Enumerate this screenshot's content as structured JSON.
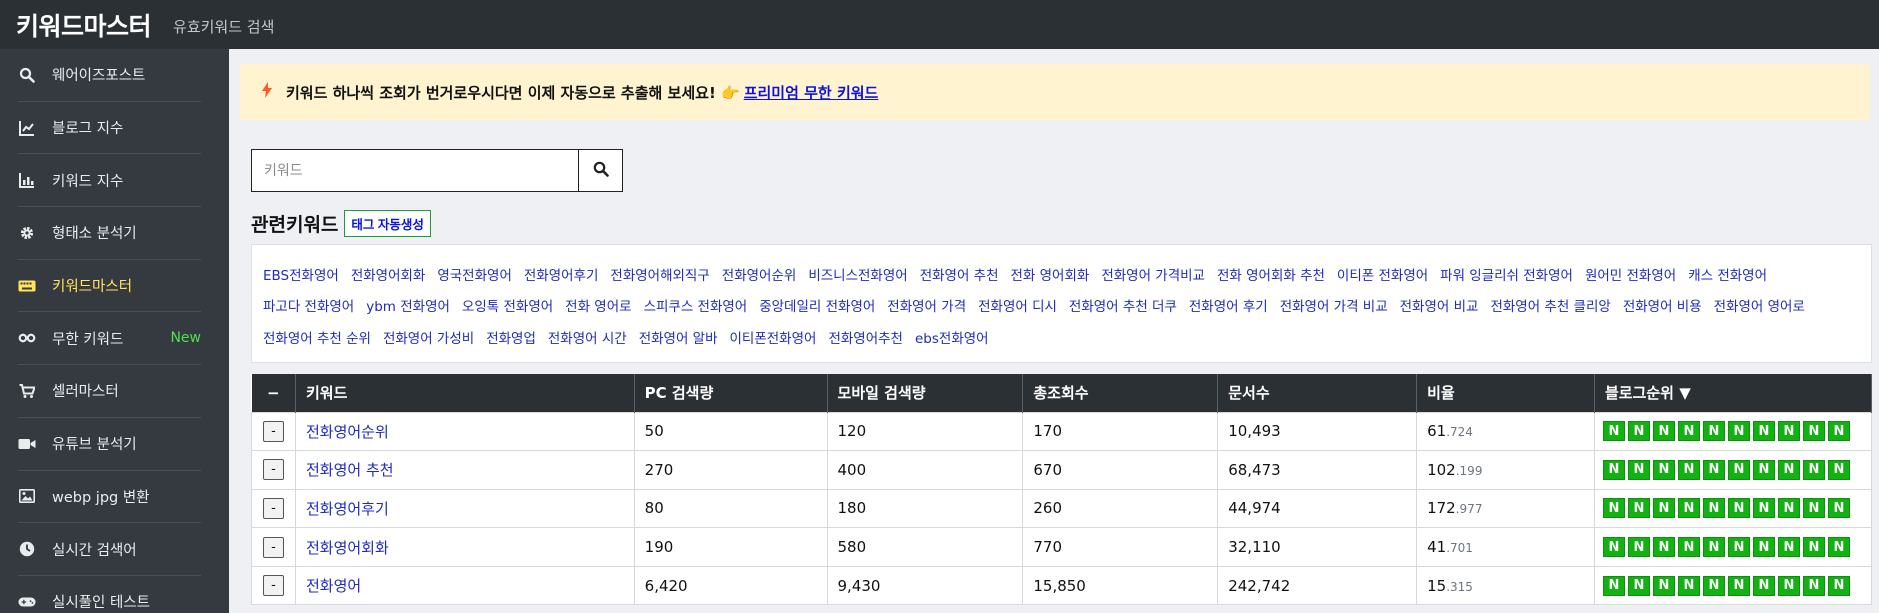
{
  "header": {
    "brand": "키워드마스터",
    "subtitle": "유효키워드 검색"
  },
  "colors": {
    "topbar": "#2b3035",
    "sidebar": "#343a40",
    "active": "#ffe45c",
    "new_badge": "#4ee24e",
    "naver_badge": "#12b212",
    "link": "#1f2bbd",
    "notice_bg": "#fff4cf"
  },
  "sidebar": {
    "items": [
      {
        "label": "웨어이즈포스트",
        "icon": "search-icon"
      },
      {
        "label": "블로그 지수",
        "icon": "line-chart-icon"
      },
      {
        "label": "키워드 지수",
        "icon": "bar-chart-icon"
      },
      {
        "label": "형태소 분석기",
        "icon": "gear-icon"
      },
      {
        "label": "키워드마스터",
        "icon": "keyboard-icon",
        "active": true
      },
      {
        "label": "무한 키워드",
        "icon": "infinity-icon",
        "badge": "New"
      },
      {
        "label": "셀러마스터",
        "icon": "cart-icon"
      },
      {
        "label": "유튜브 분석기",
        "icon": "video-camera-icon"
      },
      {
        "label": "webp jpg 변환",
        "icon": "image-icon"
      },
      {
        "label": "실시간 검색어",
        "icon": "clock-icon"
      },
      {
        "label": "실시풀인 테스트",
        "icon": "gamepad-icon"
      }
    ]
  },
  "notice": {
    "text": "키워드 하나씩 조회가 번거로우시다면 이제 자동으로 추출해 보세요! 👉",
    "link": "프리미엄 무한 키워드"
  },
  "search": {
    "placeholder": "키워드"
  },
  "related": {
    "title": "관련키워드",
    "tag_button": "태그 자동생성",
    "rows": [
      [
        "EBS전화영어",
        "전화영어회화",
        "영국전화영어",
        "전화영어후기",
        "전화영어해외직구",
        "전화영어순위",
        "비즈니스전화영어",
        "전화영어 추천",
        "전화 영어회화",
        "전화영어 가격비교",
        "전화 영어회화 추천",
        "이티폰 전화영어",
        "파워 잉글리쉬 전화영어",
        "원어민 전화영어",
        "캐스 전화영어"
      ],
      [
        "파고다 전화영어",
        "ybm 전화영어",
        "오잉톡 전화영어",
        "전화 영어로",
        "스피쿠스 전화영어",
        "중앙데일리 전화영어",
        "전화영어 가격",
        "전화영어 디시",
        "전화영어 추천 더쿠",
        "전화영어 후기",
        "전화영어 가격 비교",
        "전화영어 비교",
        "전화영어 추천 클리앙",
        "전화영어 비용",
        "전화영어 영어로"
      ],
      [
        "전화영어 추천 순위",
        "전화영어 가성비",
        "전화영업",
        "전화영어 시간",
        "전화영어 알바",
        "이티폰전화영어",
        "전화영어추천",
        "ebs전화영어"
      ]
    ]
  },
  "table": {
    "headers": [
      "−",
      "키워드",
      "PC 검색량",
      "모바일 검색량",
      "총조회수",
      "문서수",
      "비율",
      "블로그순위 ▼"
    ],
    "rows": [
      {
        "btn": "-",
        "keyword": "전화영어순위",
        "pc": "50",
        "mobile": "120",
        "total": "170",
        "docs": "10,493",
        "ratio_int": "61",
        "ratio_dec": ".724"
      },
      {
        "btn": "-",
        "keyword": "전화영어 추천",
        "pc": "270",
        "mobile": "400",
        "total": "670",
        "docs": "68,473",
        "ratio_int": "102",
        "ratio_dec": ".199"
      },
      {
        "btn": "-",
        "keyword": "전화영어후기",
        "pc": "80",
        "mobile": "180",
        "total": "260",
        "docs": "44,974",
        "ratio_int": "172",
        "ratio_dec": ".977"
      },
      {
        "btn": "-",
        "keyword": "전화영어회화",
        "pc": "190",
        "mobile": "580",
        "total": "770",
        "docs": "32,110",
        "ratio_int": "41",
        "ratio_dec": ".701"
      },
      {
        "btn": "-",
        "keyword": "전화영어",
        "pc": "6,420",
        "mobile": "9,430",
        "total": "15,850",
        "docs": "242,742",
        "ratio_int": "15",
        "ratio_dec": ".315"
      }
    ],
    "badge_letter": "N",
    "badges_per_row": 10
  }
}
